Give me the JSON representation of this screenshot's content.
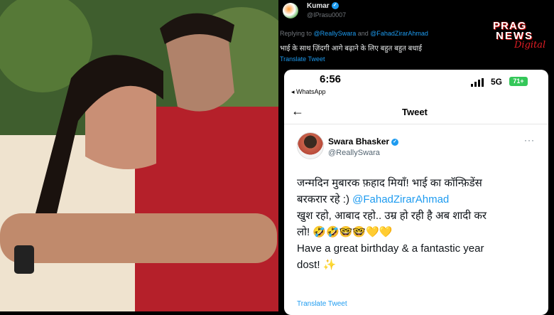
{
  "photo": {
    "alt": ""
  },
  "reply": {
    "name": "Kumar",
    "handle": "@IPrasu0007",
    "replying_prefix": "Replying to",
    "replying_to_1": "@ReallySwara",
    "replying_and": "and",
    "replying_to_2": "@FahadZirarAhmad",
    "text": "भाई के साथ ज़िंदगी आगे बढ़ाने के लिए बहुत बहुत बधाई",
    "translate": "Translate Tweet"
  },
  "logo": {
    "line1": "PRAG",
    "line2": "NEWS",
    "line3": "Digital"
  },
  "screenshot": {
    "time": "6:56",
    "back_app": "◂ WhatsApp",
    "network": "5G",
    "battery": "71+",
    "header_title": "Tweet",
    "author_name": "Swara Bhasker",
    "author_handle": "@ReallySwara",
    "more": "···",
    "line1": "जन्मदिन मुबारक फ़हाद मियाँ! भाई का कॉन्फ़िडेंस",
    "line2": "बरकरार रहे :) ",
    "mention": "@FahadZirarAhmad",
    "line3": "खुश रहो, आबाद रहो..  उम्र हो रही है अब शादी कर",
    "line4": "लो! 🤣🤣🤓🤓💛💛",
    "line5": "Have a great birthday & a fantastic year",
    "line6": "dost! ✨",
    "translate": "Translate Tweet"
  },
  "colors": {
    "link": "#1d9bf0",
    "verified": "#1d9bf0",
    "battery": "#34c759",
    "logo_red": "#e11d24"
  }
}
